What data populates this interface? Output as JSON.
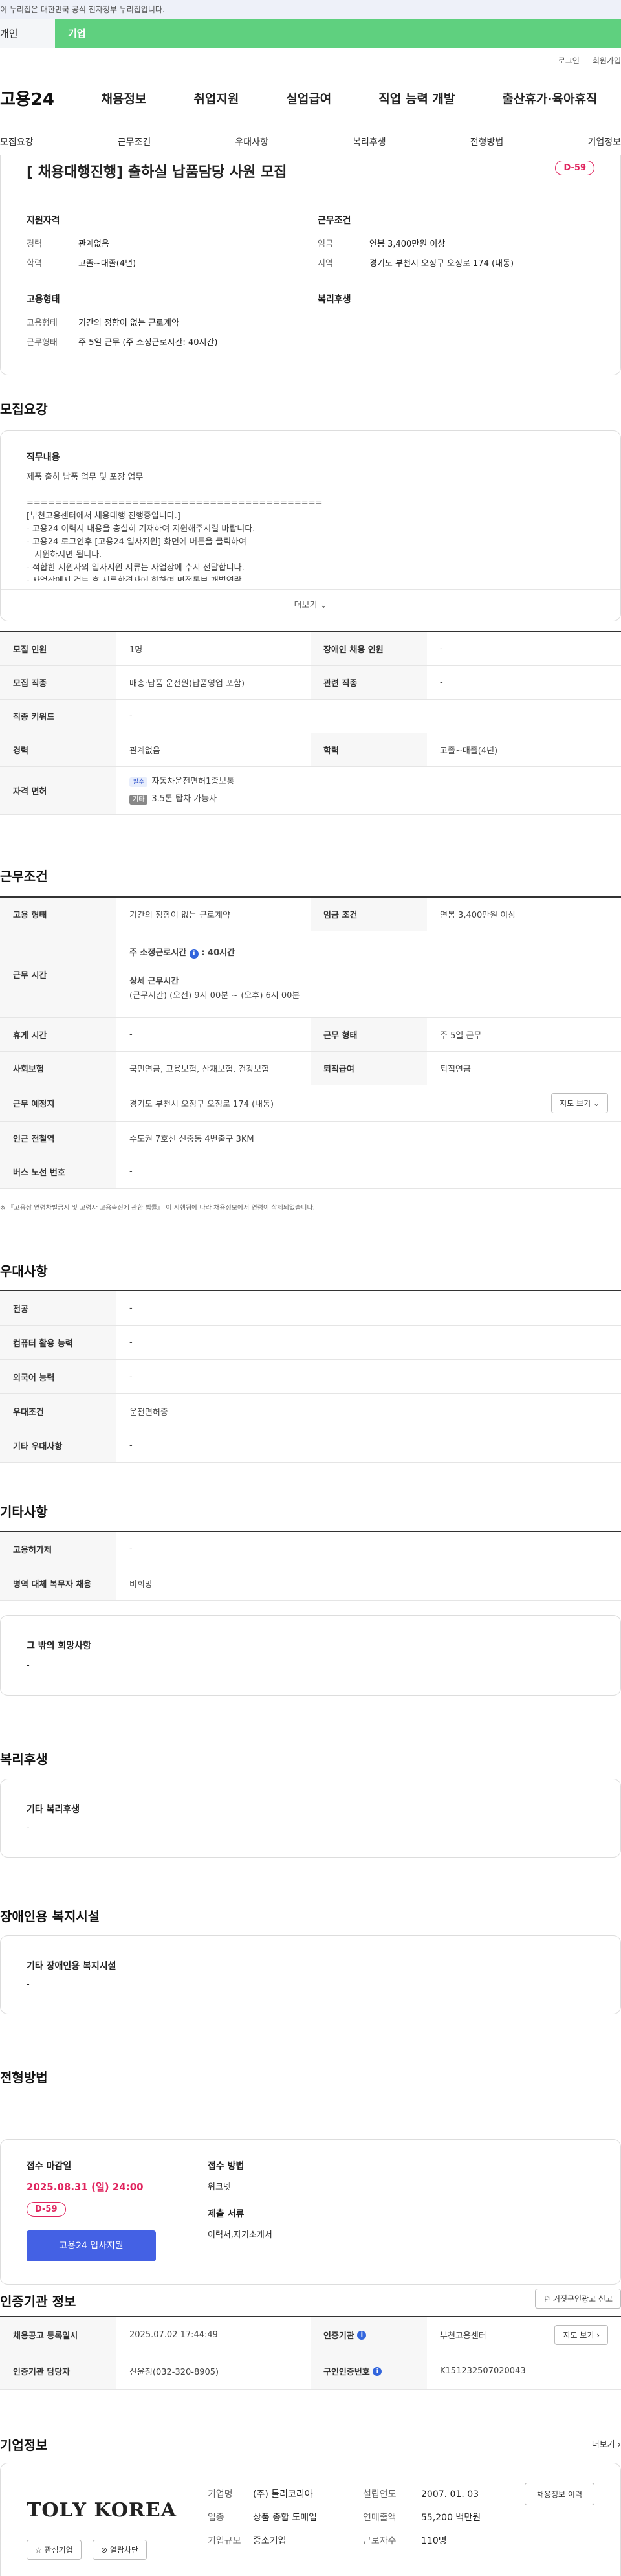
{
  "gov_banner": "이 누리집은 대한민국 공식 전자정부 누리집입니다.",
  "role_tabs": [
    "개인",
    "기업"
  ],
  "util_links": [
    "로그인",
    "회원가입"
  ],
  "logo": "고용24",
  "gnb": [
    "채용정보",
    "취업지원",
    "실업급여",
    "직업 능력 개발",
    "출산휴가·육아휴직"
  ],
  "subnav": [
    "모집요강",
    "근무조건",
    "우대사항",
    "복리후생",
    "전형방법",
    "기업정보"
  ],
  "job_title": "[ 채용대행진행] 출하실 납품담당 사원 모집",
  "dday": "D-59",
  "summary": {
    "req_title": "지원자격",
    "cond_title": "근무조건",
    "career_label": "경력",
    "career": "관계없음",
    "edu_label": "학력",
    "edu": "고졸~대졸(4년)",
    "wage_label": "임금",
    "wage": "연봉 3,400만원 이상",
    "region_label": "지역",
    "region": "경기도 부천시 오정구 오정로 174 (내동)",
    "emp_title": "고용형태",
    "welfare_title": "복리후생",
    "emptype_label": "고용형태",
    "emptype": "기간의 정함이 없는 근로계약",
    "worktype_label": "근무형태",
    "worktype": "주 5일 근무 (주 소정근로시간: 40시간)"
  },
  "recruit": {
    "title": "모집요강",
    "duty_title": "직무내용",
    "duty_lines": [
      "제품 출하 납품 업무 및 포장 업무",
      "",
      "==========================================",
      "[부천고용센터에서 채용대행 진행중입니다.]",
      "- 고용24 이력서 내용을 충실히 기재하여 지원해주시길 바랍니다.",
      "- 고용24 로그인후 [고용24 입사지원] 화면에 버튼을 클릭하여",
      "   지원하시면 됩니다.",
      "- 적합한 지원자의 입사지원 서류는 사업장에 수시 전달합니다.",
      "- 사업장에서 검토 후 서류합격자에 한하여 면접통보 개별연락"
    ],
    "more": "더보기",
    "rows": [
      {
        "k1": "모집 인원",
        "v1": "1명",
        "k2": "장애인 채용 인원",
        "v2": "-"
      },
      {
        "k1": "모집 직종",
        "v1": "배송·납품 운전원(납품영업 포함)",
        "k2": "관련 직종",
        "v2": "-"
      },
      {
        "k1": "직종 키워드",
        "v1": "-"
      },
      {
        "k1": "경력",
        "v1": "관계없음",
        "k2": "학력",
        "v2": "고졸~대졸(4년)"
      }
    ],
    "license_label": "자격 면허",
    "license_tag1": "필수",
    "license1": "자동차운전면허1종보통",
    "license_tag2": "기타",
    "license2": "3.5톤 탑차 가능자"
  },
  "work": {
    "title": "근무조건",
    "emptype_k": "고용 형태",
    "emptype_v": "기간의 정함이 없는 근로계약",
    "wage_k": "임금 조건",
    "wage_v": "연봉 3,400만원 이상",
    "hours_k": "근무 시간",
    "hours_main": "주 소정근로시간",
    "hours_main_v": ": 40시간",
    "hours_detail_t": "상세 근무시간",
    "hours_detail": "(근무시간) (오전) 9시 00분 ~ (오후) 6시 00분",
    "rest_k": "휴게 시간",
    "rest_v": "-",
    "type_k": "근무 형태",
    "type_v": "주 5일 근무",
    "ins_k": "사회보험",
    "ins_v": "국민연금, 고용보험, 산재보험, 건강보험",
    "ret_k": "퇴직급여",
    "ret_v": "퇴직연금",
    "place_k": "근무 예정지",
    "place_v": "경기도 부천시 오정구 오정로 174 (내동)",
    "map_btn": "지도 보기",
    "subway_k": "인근 전철역",
    "subway_v": "수도권 7호선 신중동 4번출구 3KM",
    "bus_k": "버스 노선 번호",
    "bus_v": "-",
    "note": "※ 『고용상 연령차별금지 및 고령자 고용촉진에 관한 법률』 이 시행됨에 따라 채용정보에서 연령이 삭제되었습니다."
  },
  "pref": {
    "title": "우대사항",
    "rows": [
      {
        "k": "전공",
        "v": "-"
      },
      {
        "k": "컴퓨터 활용 능력",
        "v": "-"
      },
      {
        "k": "외국어 능력",
        "v": "-"
      },
      {
        "k": "우대조건",
        "v": "운전면허증"
      },
      {
        "k": "기타 우대사항",
        "v": "-"
      }
    ]
  },
  "etc": {
    "title": "기타사항",
    "rows": [
      {
        "k": "고용허가제",
        "v": "-"
      },
      {
        "k": "병역 대체 복무자 채용",
        "v": "비희망"
      }
    ],
    "hope_title": "그 밖의 희망사항",
    "hope_v": "-"
  },
  "welfare": {
    "title": "복리후생",
    "sub": "기타 복리후생",
    "v": "-"
  },
  "disabled": {
    "title": "장애인용 복지시설",
    "sub": "기타 장애인용 복지시설",
    "v": "-"
  },
  "process": {
    "title": "전형방법",
    "deadline_t": "접수 마감일",
    "deadline": "2025.08.31 (일) 24:00",
    "dday": "D-59",
    "apply_btn": "고용24 입사지원",
    "method_t": "접수 방법",
    "method": "워크넷",
    "docs_t": "제출 서류",
    "docs": "이력서,자기소개서"
  },
  "agency": {
    "title": "인증기관 정보",
    "report_btn": "거짓구인광고 신고",
    "reg_k": "채용공고 등록일시",
    "reg_v": "2025.07.02 17:44:49",
    "org_k": "인증기관",
    "org_v": "부천고용센터",
    "map_btn": "지도 보기",
    "mgr_k": "인증기관 담당자",
    "mgr_v": "신윤정(032-320-8905)",
    "no_k": "구인인증번호",
    "no_v": "K151232507020043"
  },
  "company": {
    "title": "기업정보",
    "more": "더보기",
    "logo_text": "TOLY KOREA",
    "fav_btn": "관심기업",
    "block_btn": "열람차단",
    "name_k": "기업명",
    "name_v": "(주) 톨리코리아",
    "founded_k": "설립연도",
    "founded_v": "2007. 01. 03",
    "industry_k": "업종",
    "industry_v": "상품 종합 도매업",
    "sales_k": "연매출액",
    "sales_v": "55,200 백만원",
    "size_k": "기업규모",
    "size_v": "중소기업",
    "emp_k": "근로자수",
    "emp_v": "110명",
    "history_btn": "채용정보 이력"
  }
}
